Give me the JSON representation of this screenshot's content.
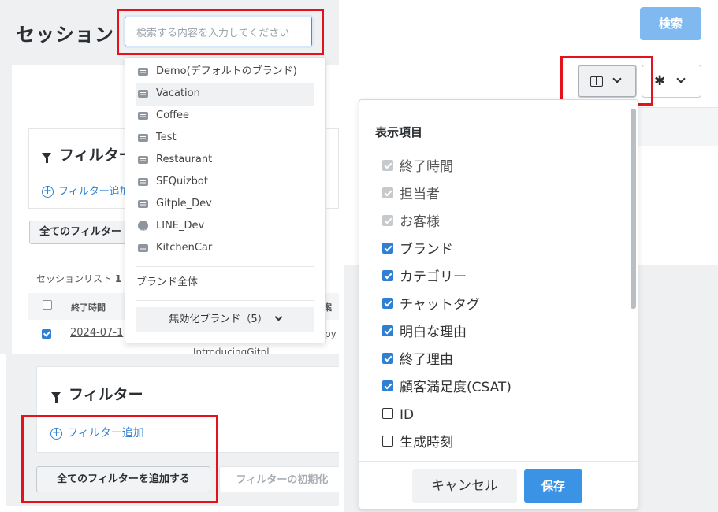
{
  "page": {
    "title": "セッション"
  },
  "search": {
    "placeholder": "検索する内容を入力してください",
    "button_label": "検索"
  },
  "brand_dropdown": {
    "items": [
      {
        "label": "Demo(デフォルトのブランド)",
        "icon": "chat-icon"
      },
      {
        "label": "Vacation",
        "icon": "chat-icon"
      },
      {
        "label": "Coffee",
        "icon": "chat-icon"
      },
      {
        "label": "Test",
        "icon": "chat-icon"
      },
      {
        "label": "Restaurant",
        "icon": "chat-icon"
      },
      {
        "label": "SFQuizbot",
        "icon": "chat-icon"
      },
      {
        "label": "Gitple_Dev",
        "icon": "chat-icon"
      },
      {
        "label": "LINE_Dev",
        "icon": "line-icon"
      },
      {
        "label": "KitchenCar",
        "icon": "chat-icon"
      }
    ],
    "all_brands": "ブランド全体",
    "disabled_brands": "無効化ブランド（5）"
  },
  "filter_top": {
    "title": "フィルター",
    "add": "フィルター追加",
    "add_all": "全てのフィルター"
  },
  "session_list": {
    "caption": "セッションリスト",
    "count": "1",
    "col_end_time": "終了時間",
    "col_right": "案",
    "row_date": "2024-07-1",
    "row_extra": "IntroducingGitpl",
    "row_right": "py"
  },
  "filter_bottom": {
    "title": "フィルター",
    "add": "フィルター追加",
    "add_all": "全てのフィルターを追加する",
    "reset": "フィルターの初期化"
  },
  "column_picker": {
    "title": "表示項目",
    "options": [
      {
        "label": "終了時間",
        "state": "disabled-checked"
      },
      {
        "label": "担当者",
        "state": "disabled-checked"
      },
      {
        "label": "お客様",
        "state": "disabled-checked"
      },
      {
        "label": "ブランド",
        "state": "checked"
      },
      {
        "label": "カテゴリー",
        "state": "checked"
      },
      {
        "label": "チャットタグ",
        "state": "checked"
      },
      {
        "label": "明白な理由",
        "state": "checked"
      },
      {
        "label": "終了理由",
        "state": "checked"
      },
      {
        "label": "顧客満足度(CSAT)",
        "state": "checked"
      },
      {
        "label": "ID",
        "state": "unchecked"
      },
      {
        "label": "生成時刻",
        "state": "unchecked"
      }
    ],
    "cancel": "キャンセル",
    "save": "保存"
  },
  "colors": {
    "accent": "#2f7fd3",
    "highlight": "#e3121d",
    "search_button": "#7fb9ef"
  }
}
